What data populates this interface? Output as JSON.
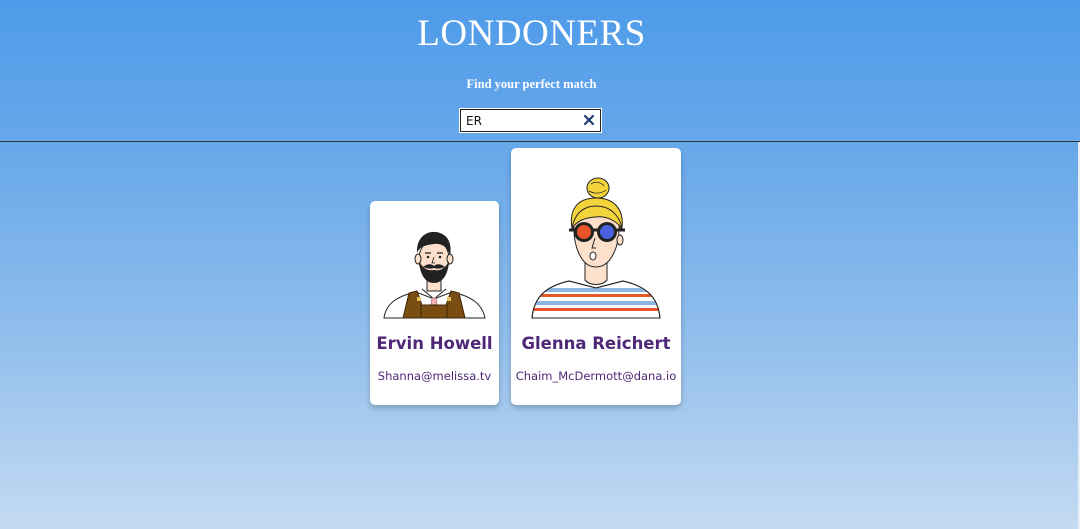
{
  "header": {
    "title": "LONDONERS",
    "subtitle": "Find your perfect match"
  },
  "search": {
    "value": "ER",
    "clear_icon": "close-icon"
  },
  "colors": {
    "name_text": "#4e2877",
    "background_top": "#4e9be9",
    "background_bottom": "#c4daf2"
  },
  "cards": [
    {
      "name": "Ervin Howell",
      "email": "Shanna@melissa.tv",
      "avatar": "bearded-man-avatar"
    },
    {
      "name": "Glenna Reichert",
      "email": "Chaim_McDermott@dana.io",
      "avatar": "blonde-woman-sunglasses-avatar"
    }
  ]
}
